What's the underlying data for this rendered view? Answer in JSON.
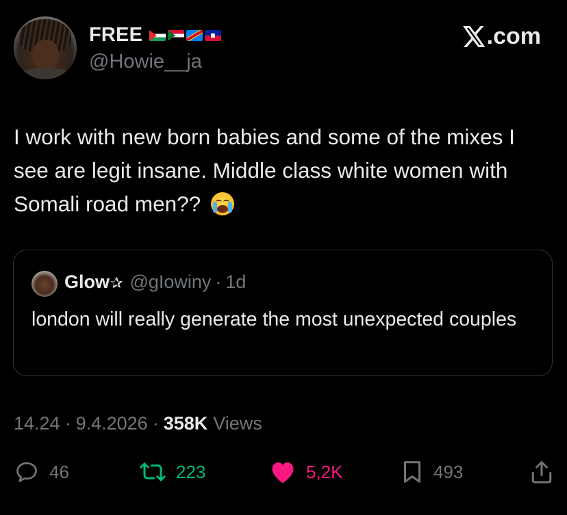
{
  "brand": {
    "text": ".com",
    "icon": "x-logo"
  },
  "author": {
    "display_name": "FREE",
    "flags": [
      "Palestine",
      "Sudan",
      "DR Congo",
      "Haiti"
    ],
    "handle": "@Howie__ja"
  },
  "tweet": {
    "text": "I work with new born babies and some of the mixes I see are legit insane. Middle class white women with Somali road men??",
    "emoji": "loudly-crying-face"
  },
  "quoted": {
    "display_name": "Glow",
    "name_suffix": "✰",
    "handle": "@gIowiny",
    "separator": "·",
    "time": "1d",
    "text": "london will really generate the most unexpected couples"
  },
  "meta": {
    "time": "14.24",
    "date": "9.4.2026",
    "separator": "·",
    "views_count": "358K",
    "views_label": "Views"
  },
  "actions": {
    "replies": "46",
    "reposts": "223",
    "likes": "5,2K",
    "bookmarks": "493"
  },
  "colors": {
    "background": "#000000",
    "text": "#e7e9ea",
    "muted": "#71767b",
    "repost_active": "#00ba7c",
    "like_active": "#f91880",
    "border": "#2f3336"
  }
}
